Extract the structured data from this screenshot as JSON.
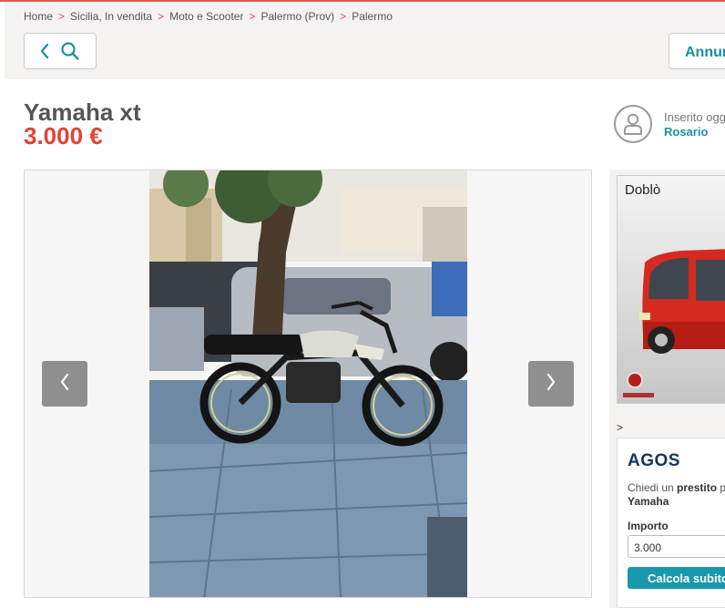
{
  "breadcrumb": {
    "items": [
      "Home",
      "Sicilia, In vendita",
      "Moto e Scooter",
      "Palermo (Prov)",
      "Palermo"
    ],
    "separator": ">"
  },
  "header": {
    "annunci_label": "Annunci"
  },
  "listing": {
    "title": "Yamaha xt",
    "price": "3.000 €"
  },
  "seller": {
    "posted_label": "Inserito oggi",
    "name": "Rosario"
  },
  "ad": {
    "title": "Doblò"
  },
  "ad_marker": ">",
  "loan": {
    "brand": "AGOS",
    "text_prefix": "Chiedi un ",
    "text_bold": "prestito",
    "text_suffix": " per",
    "product": "Yamaha",
    "amount_label": "Importo",
    "amount_value": "3.000",
    "cta": "Calcola subito"
  },
  "colors": {
    "accent": "#1a8fa3",
    "price": "#e04236",
    "brand_agos": "#13355f"
  }
}
